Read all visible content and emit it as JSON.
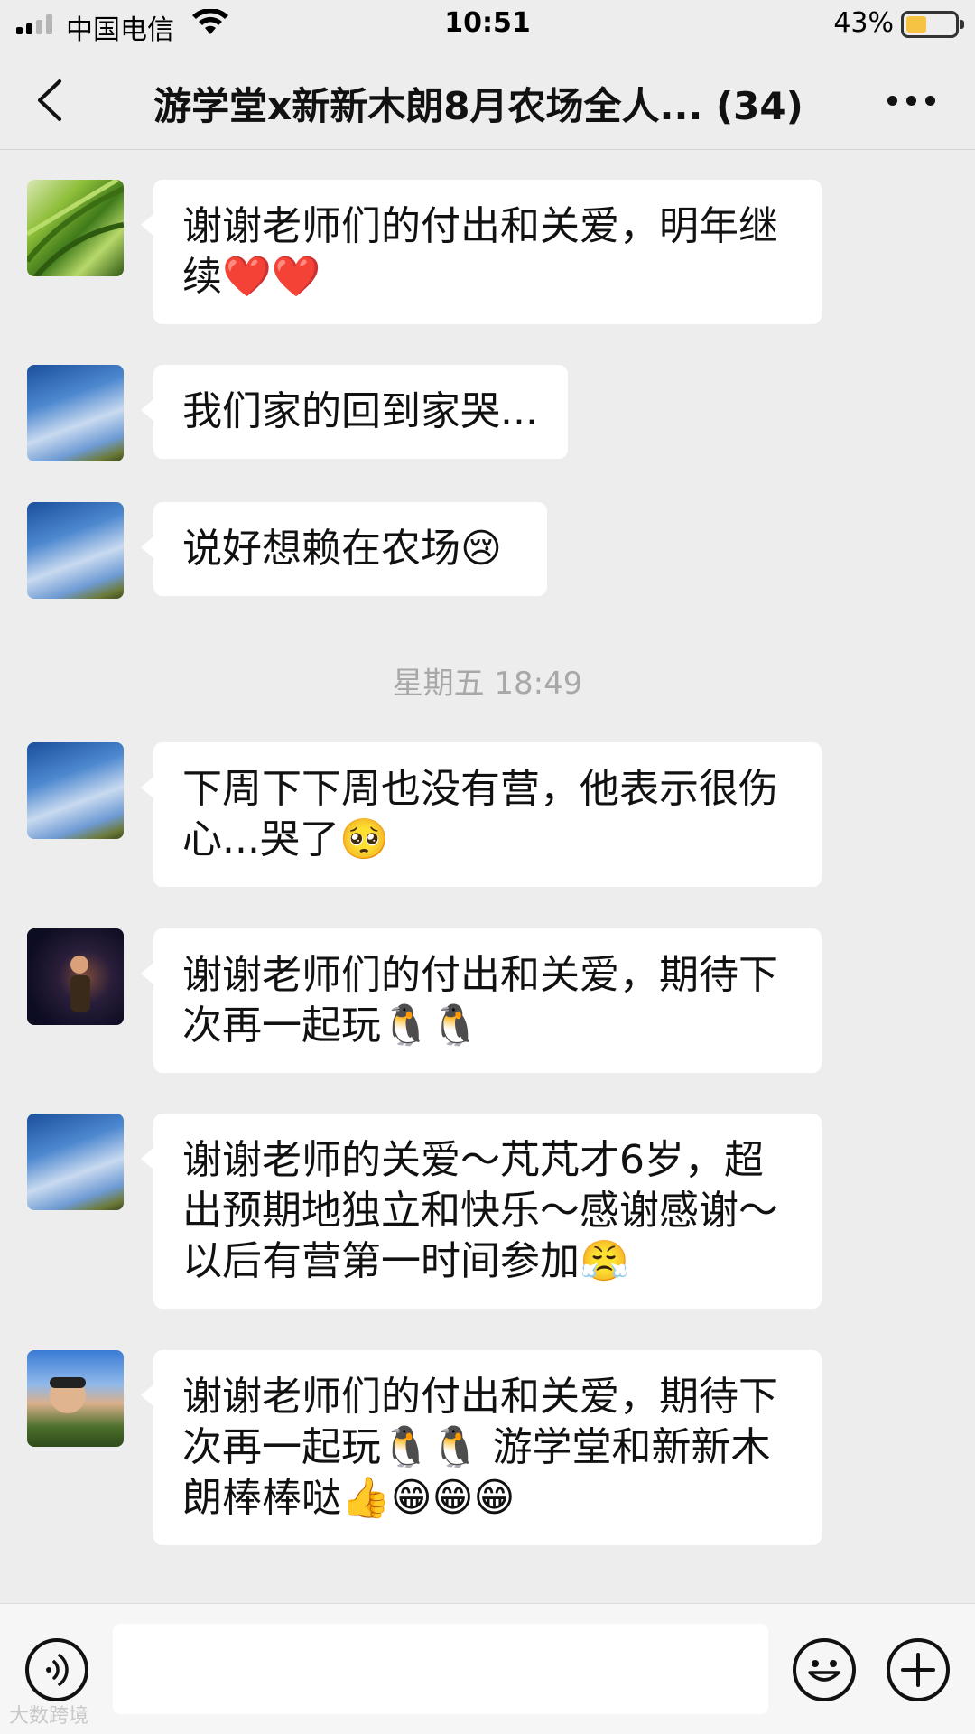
{
  "status_bar": {
    "carrier": "中国电信",
    "time": "10:51",
    "battery_percent": "43%",
    "battery_level": 0.43,
    "battery_color": "#f6c343",
    "signal_icon": "signal-icon",
    "wifi_icon": "wifi-icon"
  },
  "nav": {
    "title": "游学堂x新新木朗8月农场全人... (34)",
    "back_icon": "chevron-left-icon",
    "more_icon": "more-dots-icon"
  },
  "messages": [
    {
      "avatar": "grass",
      "text": "谢谢老师们的付出和关爱，明年继续❤️❤️"
    },
    {
      "avatar": "sky",
      "text": "我们家的回到家哭..."
    },
    {
      "avatar": "sky",
      "text": "说好想赖在农场😢"
    },
    {
      "avatar": "sky",
      "text": "下周下下周也没有营，他表示很伤心...哭了🥺"
    },
    {
      "avatar": "dark",
      "text": "谢谢老师们的付出和关爱，期待下次再一起玩🐧🐧"
    },
    {
      "avatar": "sky",
      "text": "谢谢老师的关爱～芃芃才6岁，超出预期地独立和快乐～感谢感谢～以后有营第一时间参加😤"
    },
    {
      "avatar": "person",
      "text": "谢谢老师们的付出和关爱，期待下次再一起玩🐧🐧 游学堂和新新木朗棒棒哒👍😁😁😁"
    }
  ],
  "timestamp": "星期五 18:49",
  "input_bar": {
    "placeholder": "",
    "voice_icon": "voice-icon",
    "emoji_icon": "emoji-icon",
    "plus_icon": "plus-icon"
  },
  "watermark": "大数跨境"
}
